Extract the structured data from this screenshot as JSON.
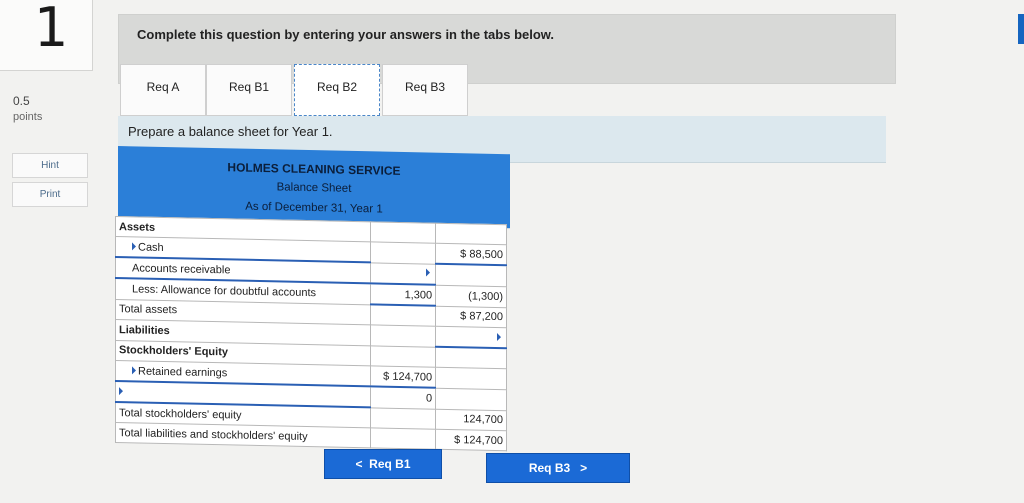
{
  "question": {
    "number": "1",
    "points_value": "0.5",
    "points_label": "points"
  },
  "side": {
    "hint": "Hint",
    "print": "Print"
  },
  "instruction": "Complete this question by entering your answers in the tabs below.",
  "tabs": [
    {
      "label": "Req A"
    },
    {
      "label": "Req B1"
    },
    {
      "label": "Req B2"
    },
    {
      "label": "Req B3"
    }
  ],
  "active_tab": "Req B2",
  "prompt": "Prepare a balance sheet for Year 1.",
  "sheet": {
    "company": "HOLMES CLEANING SERVICE",
    "title": "Balance Sheet",
    "date": "As of December 31, Year 1",
    "rows": {
      "assets": "Assets",
      "cash": "Cash",
      "cash_val": "$ 88,500",
      "ar": "Accounts receivable",
      "allowance": "Less: Allowance for doubtful accounts",
      "allowance_c1": "1,300",
      "allowance_c2": "(1,300)",
      "total_assets": "Total assets",
      "total_assets_val": "$ 87,200",
      "liabilities": "Liabilities",
      "se": "Stockholders' Equity",
      "re": "Retained earnings",
      "re_val": "$ 124,700",
      "blank_val": "0",
      "total_se": "Total stockholders' equity",
      "total_se_val": "124,700",
      "total_lse": "Total liabilities and stockholders' equity",
      "total_lse_val": "$ 124,700"
    }
  },
  "nav": {
    "prev": "Req B1",
    "next": "Req B3",
    "prev_glyph": "<",
    "next_glyph": ">"
  },
  "colors": {
    "accent": "#1b6ad6",
    "header_band": "#2b7fd8"
  }
}
